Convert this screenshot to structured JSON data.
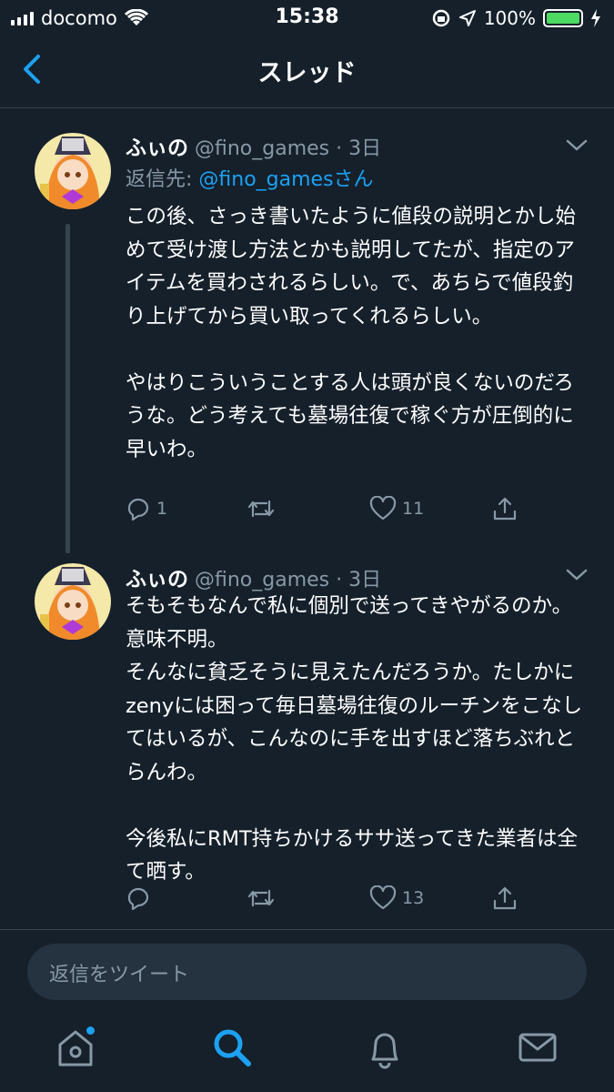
{
  "status_bar": {
    "carrier": "docomo",
    "time": "15:38",
    "battery": "100%",
    "battery_level": 1.0
  },
  "nav": {
    "title": "スレッド",
    "back_icon": "chevron-left-icon"
  },
  "tweets": [
    {
      "name": "ふぃの",
      "handle": "@fino_games",
      "time": "· 3日",
      "replying_prefix": "返信先: ",
      "replying_to": "@fino_games",
      "replying_suffix": "さん",
      "text": "この後、さっき書いたように値段の説明とかし始めて受け渡し方法とかも説明してたが、指定のアイテムを買わされるらしい。で、あちらで値段釣り上げてから買い取ってくれるらしい。\n\nやはりこういうことする人は頭が良くないのだろうな。どう考えても墓場往復で稼ぐ方が圧倒的に早いわ。",
      "reply_count": "1",
      "retweet_count": "",
      "like_count": "11"
    },
    {
      "name": "ふぃの",
      "handle": "@fino_games",
      "time": "· 3日",
      "text": "そもそもなんで私に個別で送ってきやがるのか。意味不明。\nそんなに貧乏そうに見えたんだろうか。たしかにzenyには困って毎日墓場往復のルーチンをこなしてはいるが、こんなのに手を出すほど落ちぶれとらんわ。\n\n今後私にRMT持ちかけるササ送ってきた業者は全て晒す。",
      "reply_count": "",
      "retweet_count": "",
      "like_count": "13"
    }
  ],
  "reply_box": {
    "placeholder": "返信をツイート"
  },
  "tab_bar": {
    "items": [
      "home-icon",
      "search-icon",
      "notifications-icon",
      "messages-icon"
    ],
    "active": "search-icon"
  },
  "colors": {
    "background": "#15202b",
    "accent": "#1da1f2",
    "secondary_text": "#8899a6",
    "divider": "#38444d"
  }
}
